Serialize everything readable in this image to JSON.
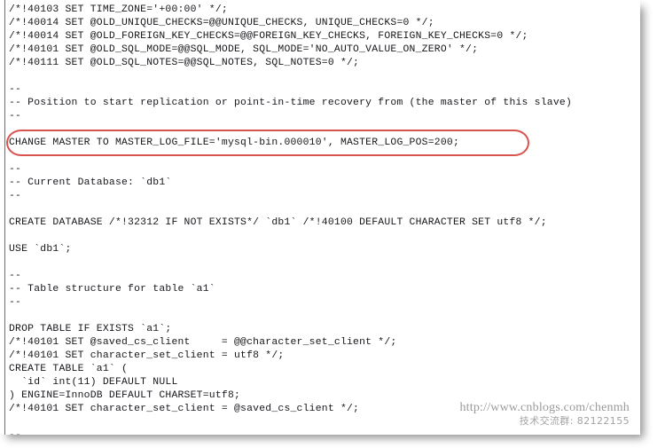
{
  "document": {
    "kind": "mysqldump-sql-output",
    "lines": [
      "/*!40103 SET TIME_ZONE='+00:00' */;",
      "/*!40014 SET @OLD_UNIQUE_CHECKS=@@UNIQUE_CHECKS, UNIQUE_CHECKS=0 */;",
      "/*!40014 SET @OLD_FOREIGN_KEY_CHECKS=@@FOREIGN_KEY_CHECKS, FOREIGN_KEY_CHECKS=0 */;",
      "/*!40101 SET @OLD_SQL_MODE=@@SQL_MODE, SQL_MODE='NO_AUTO_VALUE_ON_ZERO' */;",
      "/*!40111 SET @OLD_SQL_NOTES=@@SQL_NOTES, SQL_NOTES=0 */;",
      "",
      "--",
      "-- Position to start replication or point-in-time recovery from (the master of this slave)",
      "--",
      "",
      "CHANGE MASTER TO MASTER_LOG_FILE='mysql-bin.000010', MASTER_LOG_POS=200;",
      "",
      "--",
      "-- Current Database: `db1`",
      "--",
      "",
      "CREATE DATABASE /*!32312 IF NOT EXISTS*/ `db1` /*!40100 DEFAULT CHARACTER SET utf8 */;",
      "",
      "USE `db1`;",
      "",
      "--",
      "-- Table structure for table `a1`",
      "--",
      "",
      "DROP TABLE IF EXISTS `a1`;",
      "/*!40101 SET @saved_cs_client     = @@character_set_client */;",
      "/*!40101 SET character_set_client = utf8 */;",
      "CREATE TABLE `a1` (",
      "  `id` int(11) DEFAULT NULL",
      ") ENGINE=InnoDB DEFAULT CHARSET=utf8;",
      "/*!40101 SET character_set_client = @saved_cs_client */;",
      "",
      "--"
    ]
  },
  "annotation": {
    "highlight_label": "CHANGE MASTER TO MASTER_LOG_FILE='mysql-bin.000010', MASTER_LOG_POS=200;",
    "highlight_color": "#d9534f",
    "highlight_shape": "rounded-rectangle"
  },
  "watermark": {
    "url": "http://www.cnblogs.com/chenmh",
    "qq_group": "技术交流群: 82122155"
  },
  "colors": {
    "page_background": "#ffffff",
    "text": "#17171c",
    "gutter_rule": "#6f6f6f",
    "watermark_text": "#9a9a9a",
    "accent_red": "#d9534f"
  }
}
